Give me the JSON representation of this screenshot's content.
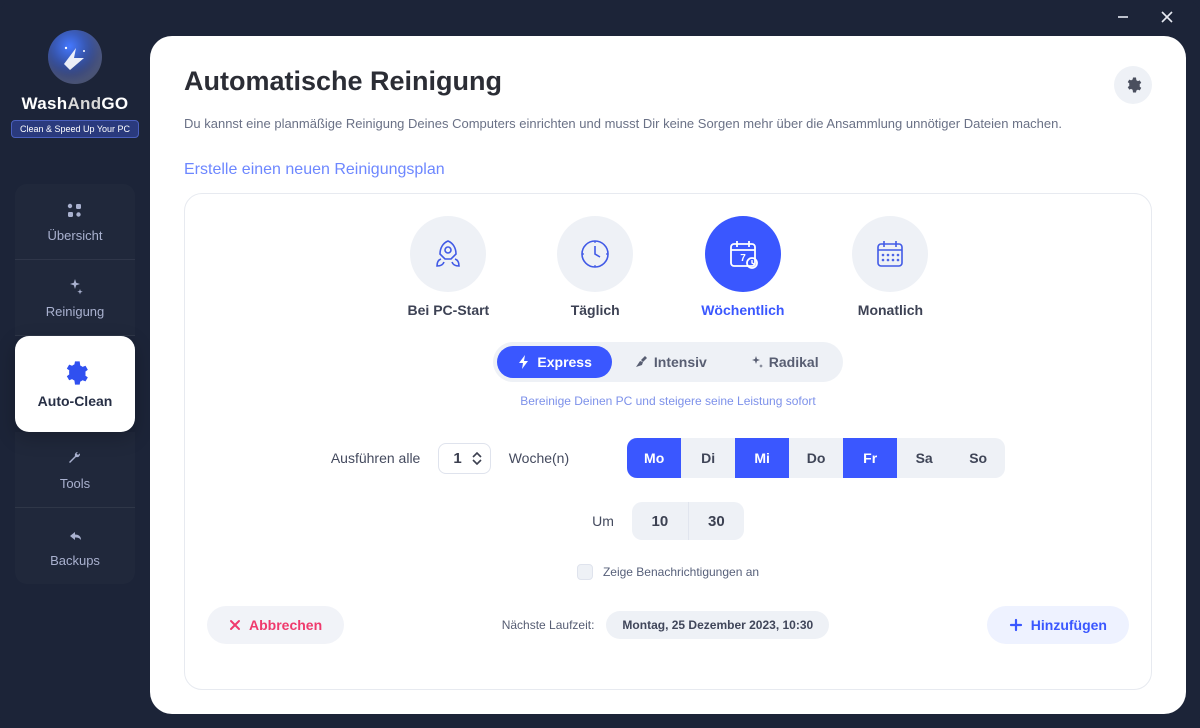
{
  "brand": {
    "name_pre": "Wash",
    "name_mid": "And",
    "name_post": "GO",
    "tagline": "Clean & Speed Up Your PC"
  },
  "nav": {
    "overview": "Übersicht",
    "cleaning": "Reinigung",
    "autoclean": "Auto-Clean",
    "tools": "Tools",
    "backups": "Backups"
  },
  "page": {
    "title": "Automatische Reinigung",
    "subtitle": "Du kannst eine planmäßige Reinigung Deines Computers einrichten und musst Dir keine Sorgen mehr über die Ansammlung unnötiger Dateien machen.",
    "section": "Erstelle einen neuen Reinigungsplan"
  },
  "schedules": {
    "pcstart": "Bei PC-Start",
    "daily": "Täglich",
    "weekly": "Wöchentlich",
    "monthly": "Monatlich"
  },
  "modes": {
    "express": "Express",
    "intensiv": "Intensiv",
    "radikal": "Radikal",
    "desc": "Bereinige Deinen PC und steigere seine Leistung sofort"
  },
  "run": {
    "every_label": "Ausführen alle",
    "every_value": "1",
    "unit_label": "Woche(n)"
  },
  "days": {
    "mo": "Mo",
    "di": "Di",
    "mi": "Mi",
    "do": "Do",
    "fr": "Fr",
    "sa": "Sa",
    "so": "So"
  },
  "time": {
    "at_label": "Um",
    "hour": "10",
    "minute": "30"
  },
  "notify": {
    "label": "Zeige Benachrichtigungen an"
  },
  "footer": {
    "cancel": "Abbrechen",
    "add": "Hinzufügen",
    "next_label": "Nächste Laufzeit:",
    "next_value": "Montag, 25 Dezember 2023, 10:30"
  }
}
